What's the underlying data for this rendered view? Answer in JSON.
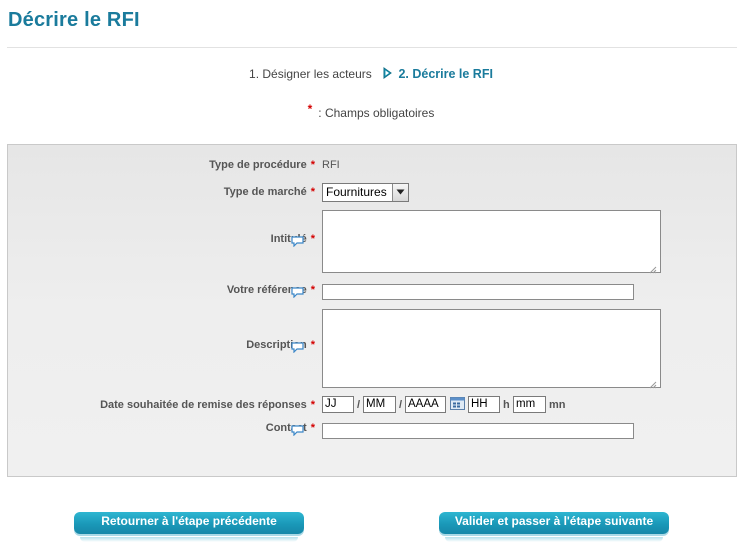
{
  "page": {
    "title": "Décrire le RFI"
  },
  "steps": {
    "step1": "1. Désigner les acteurs",
    "step2": "2. Décrire le RFI",
    "arrow_icon": "play-arrow-icon"
  },
  "mandatory": {
    "star": "*",
    "text": ": Champs obligatoires"
  },
  "form": {
    "type_procedure": {
      "label": "Type de procédure",
      "required": "*",
      "value": "RFI"
    },
    "type_marche": {
      "label": "Type de marché",
      "required": "*",
      "selected": "Fournitures"
    },
    "intitule": {
      "label": "Intitulé",
      "required": "*",
      "value": ""
    },
    "reference": {
      "label": "Votre référence",
      "required": "*",
      "value": ""
    },
    "description": {
      "label": "Description",
      "required": "*",
      "value": ""
    },
    "date_remise": {
      "label": "Date souhaitée de remise des réponses",
      "required": "*",
      "day": "JJ",
      "month": "MM",
      "year": "AAAA",
      "hour": "HH",
      "minute": "mm",
      "sep": "/",
      "h_label": "h",
      "mn_label": "mn"
    },
    "contact": {
      "label": "Contact",
      "required": "*",
      "value": ""
    }
  },
  "buttons": {
    "back": "Retourner à l'étape précédente",
    "next": "Valider et passer à l'étape suivante"
  },
  "colors": {
    "accent": "#1a7b9c",
    "required": "#d40000",
    "button": "#1a98b8"
  }
}
